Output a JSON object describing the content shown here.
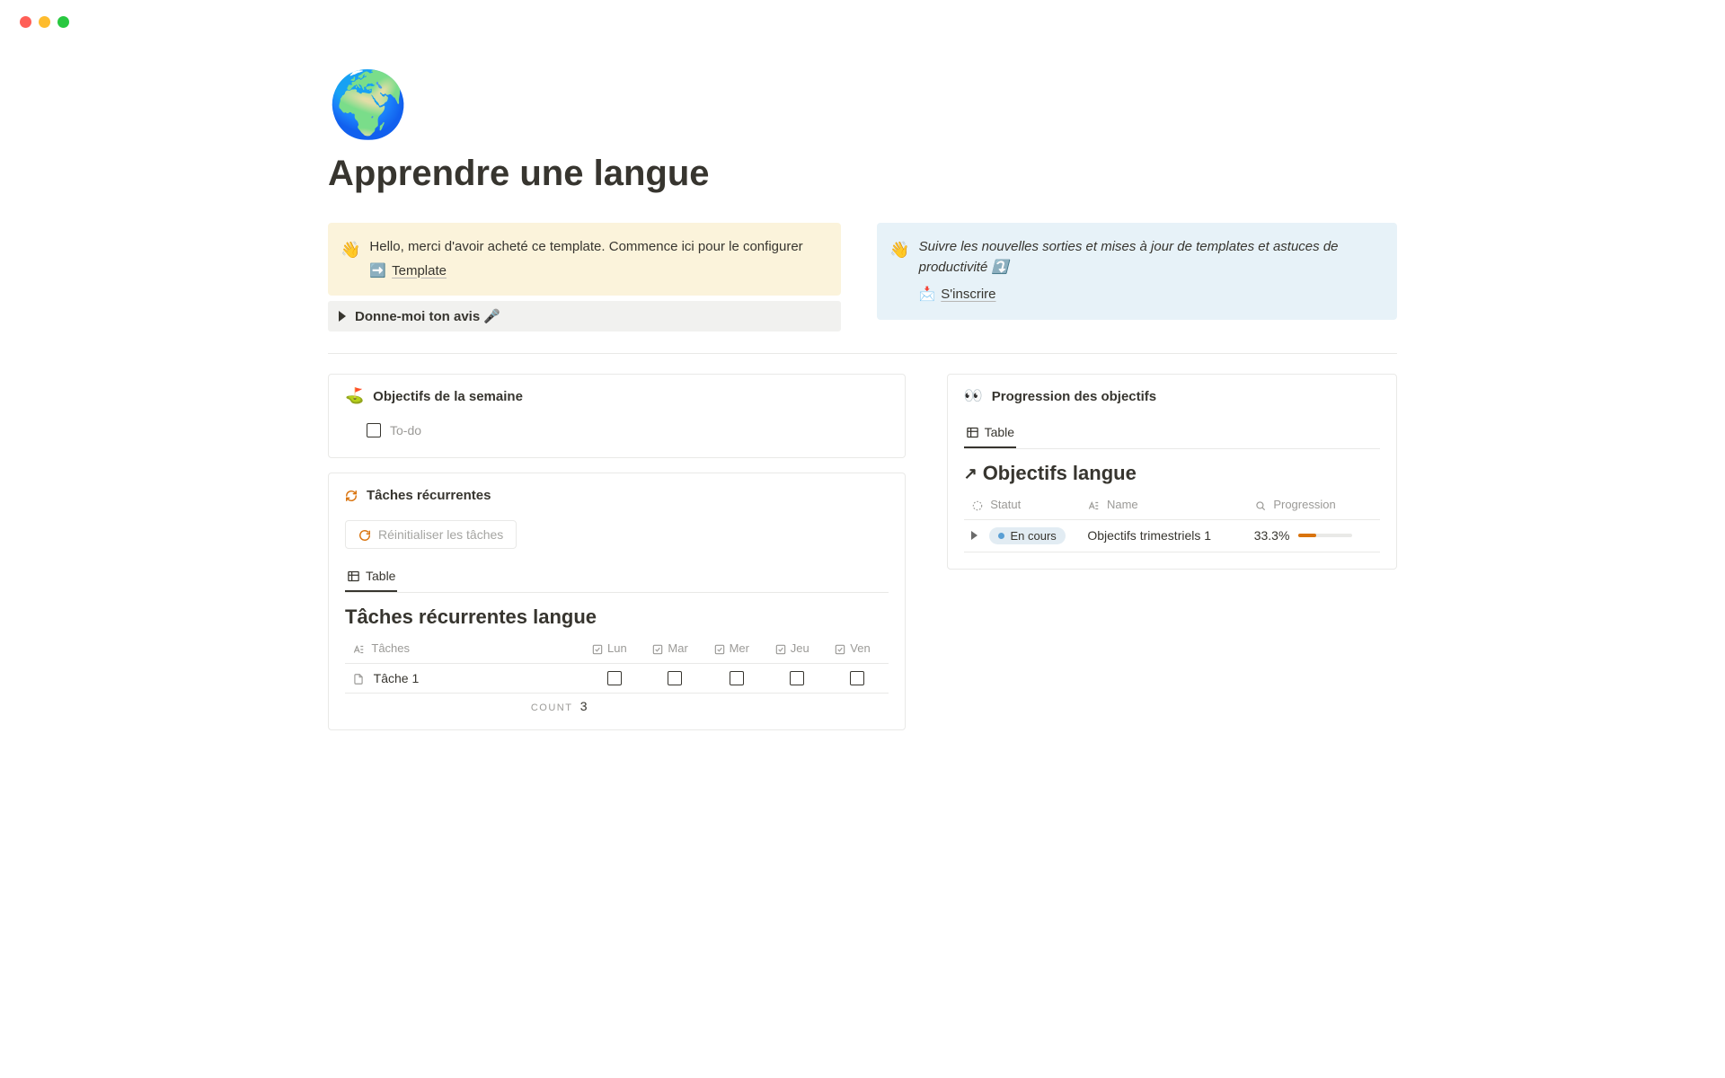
{
  "page": {
    "icon": "🌍",
    "title": "Apprendre une langue"
  },
  "callouts": {
    "welcome": {
      "emoji": "👋",
      "text": "Hello, merci d'avoir acheté ce template. Commence ici pour le configurer",
      "link_icon": "➡️",
      "link_label": "Template"
    },
    "subscribe": {
      "emoji": "👋",
      "text": "Suivre les nouvelles sorties et mises à jour de templates et astuces de productivité ⤵️",
      "link_icon": "📩",
      "link_label": "S'inscrire"
    }
  },
  "toggle": {
    "label": "Donne-moi ton avis 🎤"
  },
  "weekly": {
    "icon": "⛳",
    "title": "Objectifs de la semaine",
    "todo_placeholder": "To-do"
  },
  "recurring": {
    "icon": "🔁",
    "title": "Tâches récurrentes",
    "reset_label": "Réinitialiser les tâches",
    "tab_label": "Table",
    "db_title": "Tâches récurrentes langue",
    "columns": {
      "task": "Tâches",
      "mon": "Lun",
      "tue": "Mar",
      "wed": "Mer",
      "thu": "Jeu",
      "fri": "Ven"
    },
    "rows": [
      {
        "name": "Tâche 1",
        "mon": false,
        "tue": false,
        "wed": false,
        "thu": false,
        "fri": false
      }
    ],
    "count_label": "COUNT",
    "count_value": "3"
  },
  "progress": {
    "icon": "👀",
    "title": "Progression des objectifs",
    "tab_label": "Table",
    "db_title": "Objectifs langue",
    "columns": {
      "status": "Statut",
      "name": "Name",
      "progress": "Progression"
    },
    "rows": [
      {
        "status": "En cours",
        "name": "Objectifs trimestriels 1",
        "percent": "33.3%",
        "fill": 33.3
      }
    ]
  }
}
